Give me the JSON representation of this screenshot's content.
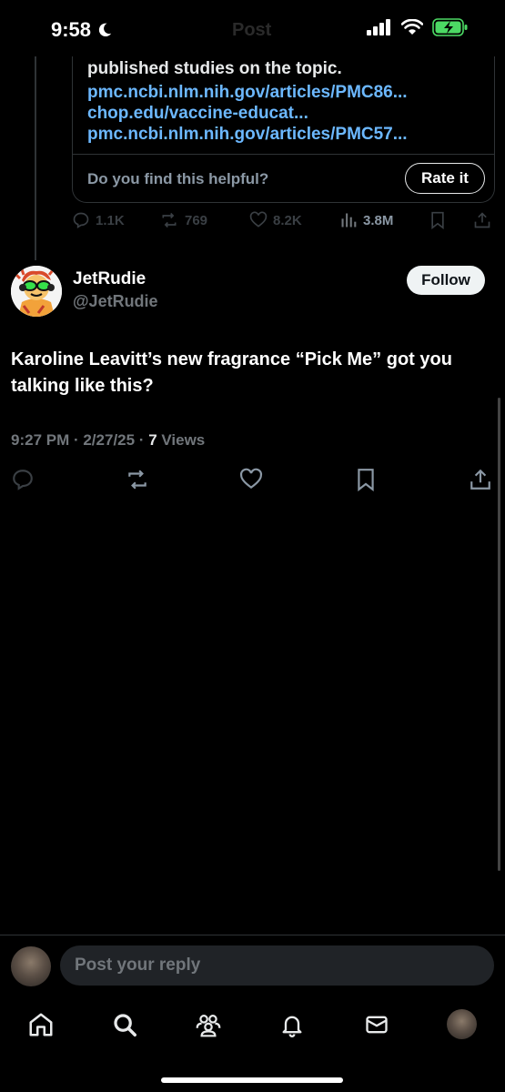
{
  "status_bar": {
    "time": "9:58"
  },
  "header": {
    "title": "Post"
  },
  "note_card": {
    "text_line": "published studies on the topic.",
    "links": [
      "pmc.ncbi.nlm.nih.gov/articles/PMC86...",
      "chop.edu/vaccine-educat...",
      "pmc.ncbi.nlm.nih.gov/articles/PMC57..."
    ],
    "helpful_question": "Do you find this helpful?",
    "rate_label": "Rate it"
  },
  "parent_actions": {
    "replies": "1.1K",
    "reposts": "769",
    "likes": "8.2K",
    "views": "3.8M"
  },
  "post": {
    "display_name": "JetRudie",
    "handle": "@JetRudie",
    "follow_label": "Follow",
    "text": "Karoline Leavitt’s new fragrance “Pick Me” got you talking like this?",
    "timestamp": "9:27 PM · 2/27/25 · ",
    "views_count": "7",
    "views_label": " Views"
  },
  "reply": {
    "placeholder": "Post your reply"
  },
  "nav": {
    "items": [
      "home-icon",
      "search-icon",
      "communities-icon",
      "notifications-icon",
      "messages-icon",
      "profile-avatar"
    ]
  },
  "colors": {
    "link": "#6cb8ff",
    "muted": "#71767b",
    "background": "#000000"
  }
}
